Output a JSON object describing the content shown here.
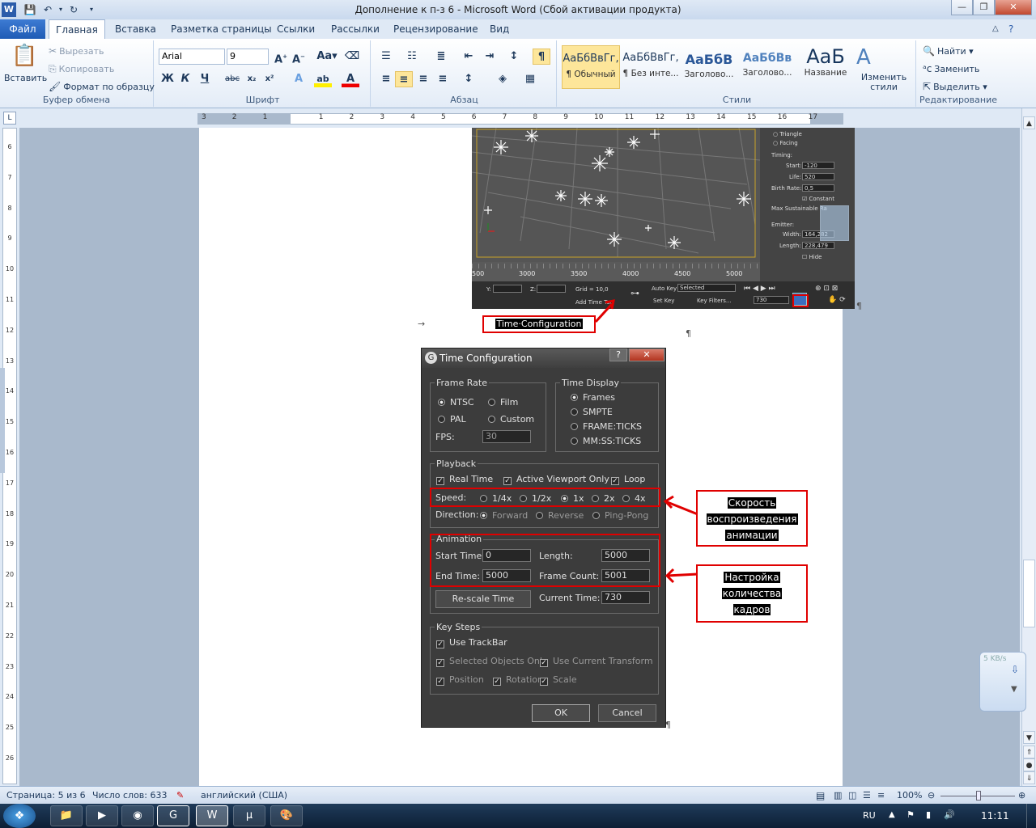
{
  "window": {
    "title": "Дополнение к п-з 6  -  Microsoft Word (Сбой активации продукта)",
    "controls": {
      "minimize": "—",
      "maximize": "❐",
      "close": "✕"
    }
  },
  "tabs": [
    "Файл",
    "Главная",
    "Вставка",
    "Разметка страницы",
    "Ссылки",
    "Рассылки",
    "Рецензирование",
    "Вид"
  ],
  "ribbon": {
    "clipboard": {
      "paste": "Вставить",
      "cut": "Вырезать",
      "copy": "Копировать",
      "format_painter": "Формат по образцу",
      "label": "Буфер обмена"
    },
    "font": {
      "name": "Arial",
      "size": "9",
      "label": "Шрифт"
    },
    "paragraph": {
      "label": "Абзац"
    },
    "styles": {
      "label": "Стили",
      "items": [
        {
          "sample": "АаБбВвГг,",
          "name": "¶ Обычный"
        },
        {
          "sample": "АаБбВвГг,",
          "name": "¶ Без инте..."
        },
        {
          "sample": "АаБбВ",
          "name": "Заголово..."
        },
        {
          "sample": "АаБбВв",
          "name": "Заголово..."
        },
        {
          "sample": "АаБ",
          "name": "Название"
        }
      ],
      "change": "Изменить стили"
    },
    "editing": {
      "find": "Найти",
      "replace": "Заменить",
      "select": "Выделить",
      "label": "Редактирование"
    }
  },
  "ruler": {
    "numbers": [
      "3",
      "2",
      "1",
      "1",
      "2",
      "3",
      "4",
      "5",
      "6",
      "7",
      "8",
      "9",
      "10",
      "11",
      "12",
      "13",
      "14",
      "15",
      "16",
      "17"
    ]
  },
  "vruler": {
    "numbers": [
      "6",
      "7",
      "8",
      "9",
      "10",
      "11",
      "12",
      "13",
      "14",
      "15",
      "16",
      "17",
      "18",
      "19",
      "20",
      "21",
      "22",
      "23",
      "24",
      "25",
      "26"
    ]
  },
  "screenshot_top": {
    "panel": {
      "shape_opts": [
        "Triangle",
        "Facing"
      ],
      "timing": "Timing:",
      "start_label": "Start:",
      "start": "-120",
      "life_label": "Life:",
      "life": "520",
      "birth_label": "Birth Rate:",
      "birth": "0,5",
      "constant": "Constant",
      "max_rate": "Max Sustainable Ra",
      "emitter": "Emitter:",
      "width_label": "Width:",
      "width": "164,282",
      "length_label": "Length:",
      "length": "228,479",
      "hide": "Hide"
    },
    "timeline": [
      "500",
      "3000",
      "3500",
      "4000",
      "4500",
      "5000"
    ],
    "bottom": {
      "y": "Y:",
      "z": "Z:",
      "grid": "Grid = 10,0",
      "auto_key": "Auto Key",
      "selected": "Selected",
      "set_key": "Set Key",
      "key_filters": "Key Filters...",
      "add_time_tag": "Add Time Tag",
      "frame": "730"
    },
    "caption": "Time·Configuration"
  },
  "time_config": {
    "title": "Time Configuration",
    "frame_rate": {
      "label": "Frame Rate",
      "ntsc": "NTSC",
      "film": "Film",
      "pal": "PAL",
      "custom": "Custom",
      "fps_label": "FPS:",
      "fps": "30"
    },
    "time_display": {
      "label": "Time Display",
      "options": [
        "Frames",
        "SMPTE",
        "FRAME:TICKS",
        "MM:SS:TICKS"
      ]
    },
    "playback": {
      "label": "Playback",
      "real_time": "Real Time",
      "active_viewport": "Active Viewport Only",
      "loop": "Loop",
      "speed_label": "Speed:",
      "speeds": [
        "1/4x",
        "1/2x",
        "1x",
        "2x",
        "4x"
      ],
      "direction_label": "Direction:",
      "directions": [
        "Forward",
        "Reverse",
        "Ping-Pong"
      ]
    },
    "animation": {
      "label": "Animation",
      "start_label": "Start Time:",
      "start": "0",
      "end_label": "End Time:",
      "end": "5000",
      "length_label": "Length:",
      "length": "5000",
      "count_label": "Frame Count:",
      "count": "5001",
      "rescale": "Re-scale Time",
      "current_label": "Current Time:",
      "current": "730"
    },
    "key_steps": {
      "label": "Key Steps",
      "use_trackbar": "Use TrackBar",
      "selected_only": "Selected Objects Only",
      "use_current": "Use Current Transform",
      "position": "Position",
      "rotation": "Rotation",
      "scale": "Scale"
    },
    "ok": "OK",
    "cancel": "Cancel"
  },
  "callouts": {
    "speed": [
      "Скорость",
      "воспроизведения",
      "анимации"
    ],
    "frames": [
      "Настройка",
      "количества",
      "кадров"
    ]
  },
  "status": {
    "page": "Страница: 5 из 6",
    "words": "Число слов: 633",
    "language": "английский (США)",
    "zoom": "100%"
  },
  "taskbar": {
    "lang": "RU",
    "time": "11:11"
  },
  "net_widget": {
    "speed": "5 KB/s"
  }
}
